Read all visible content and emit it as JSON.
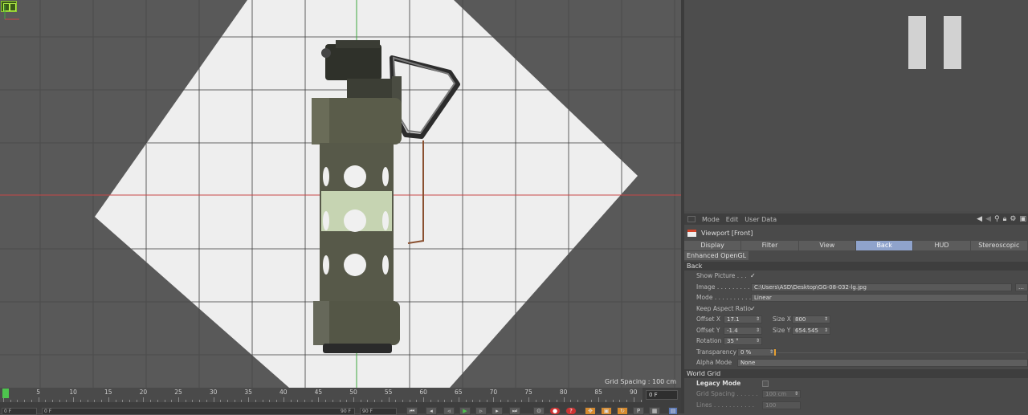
{
  "viewport": {
    "grid_spacing_label": "Grid Spacing : 100 cm"
  },
  "attributes": {
    "menu": [
      "Mode",
      "Edit",
      "User Data"
    ],
    "title": "Viewport [Front]",
    "tabs": [
      "Display",
      "Filter",
      "View",
      "Back",
      "HUD",
      "Stereoscopic"
    ],
    "active_tab": "Back",
    "extra_tab": "Enhanced OpenGL",
    "section_back": "Back",
    "show_picture_label": "Show Picture . . .",
    "image_label": "Image . . . . . . . . . .",
    "image_path": "C:\\Users\\ASD\\Desktop\\GG-08-032-lg.jpg",
    "mode_label": "Mode . . . . . . . . . .",
    "mode_value": "Linear",
    "keep_aspect_label": "Keep Aspect Ratio",
    "offset_x_label": "Offset X",
    "offset_x_value": "17.1",
    "size_x_label": "Size X",
    "size_x_value": "800",
    "offset_y_label": "Offset Y",
    "offset_y_value": "-1.4",
    "size_y_label": "Size Y",
    "size_y_value": "654.545",
    "rotation_label": "Rotation",
    "rotation_value": "35 °",
    "transparency_label": "Transparency",
    "transparency_value": "0 %",
    "alpha_mode_label": "Alpha Mode",
    "alpha_mode_value": "None",
    "section_world_grid": "World Grid",
    "legacy_mode_label": "Legacy Mode",
    "grid_spacing_label": "Grid Spacing . . . . . .",
    "grid_spacing_value": "100 cm",
    "lines_label": "Lines . . . . . . . . . . .",
    "lines_value": "100"
  },
  "timeline": {
    "ticks": [
      "0",
      "5",
      "10",
      "15",
      "20",
      "25",
      "30",
      "35",
      "40",
      "45",
      "50",
      "55",
      "60",
      "65",
      "70",
      "75",
      "80",
      "85",
      "90"
    ],
    "end_frame": "0 F",
    "current_frame": "0 F",
    "start_field": "0 F",
    "range_end": "90 F",
    "max_frame": "90 F"
  }
}
